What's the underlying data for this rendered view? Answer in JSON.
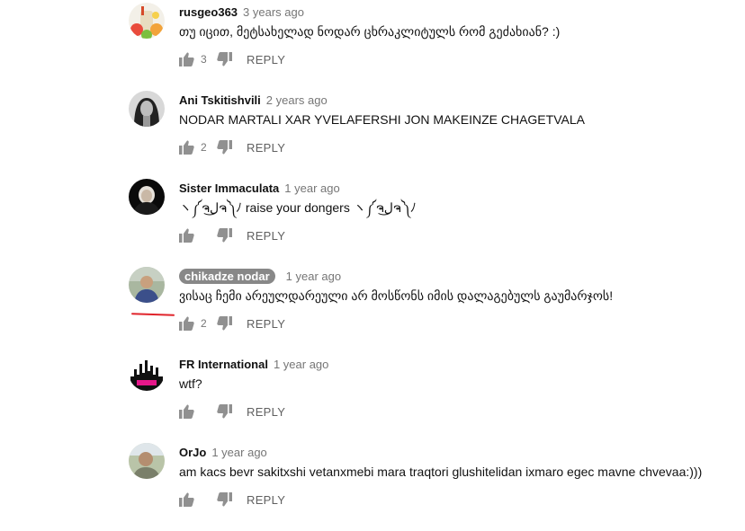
{
  "comments": [
    {
      "author": "rusgeo363",
      "time": "3 years ago",
      "text": "თუ იცით, მეტსახელად ნოდარ ცხრაკლიტულს რომ გეძახიან? :)",
      "likes": "3",
      "reply": "REPLY",
      "avatar": "fruit-smoothie-avatar"
    },
    {
      "author": "Ani Tskitishvili",
      "time": "2 years ago",
      "text": "NODAR MARTALI XAR YVELAFERSHI JON MAKEINZE CHAGETVALA",
      "likes": "2",
      "reply": "REPLY",
      "avatar": "grayscale-portrait-avatar"
    },
    {
      "author": "Sister Immaculata",
      "time": "1 year ago",
      "text": "ヽ༼ຈل͜ຈ༽ﾉ raise your dongers ヽ༼ຈل͜ຈ༽ﾉ",
      "likes": "",
      "reply": "REPLY",
      "avatar": "dark-figure-avatar"
    },
    {
      "author": "chikadze nodar",
      "time": "1 year ago",
      "text": "ვისაც ჩემი  არეულდარეული არ მოსწონს იმის დალაგებულს გაუმარჯოს!",
      "likes": "2",
      "reply": "REPLY",
      "avatar": "man-photo-avatar"
    },
    {
      "author": "FR International",
      "time": "1 year ago",
      "text": "wtf?",
      "likes": "",
      "reply": "REPLY",
      "avatar": "city-skyline-avatar"
    },
    {
      "author": "OrJo",
      "time": "1 year ago",
      "text": "am kacs bevr sakitxshi vetanxmebi mara traqtori glushitelidan ixmaro egec mavne chvevaa:)))",
      "likes": "",
      "reply": "REPLY",
      "avatar": "outdoor-photo-avatar"
    }
  ],
  "colors": {
    "author_highlight": "#888888",
    "annotation_underline": "#e0242b"
  }
}
